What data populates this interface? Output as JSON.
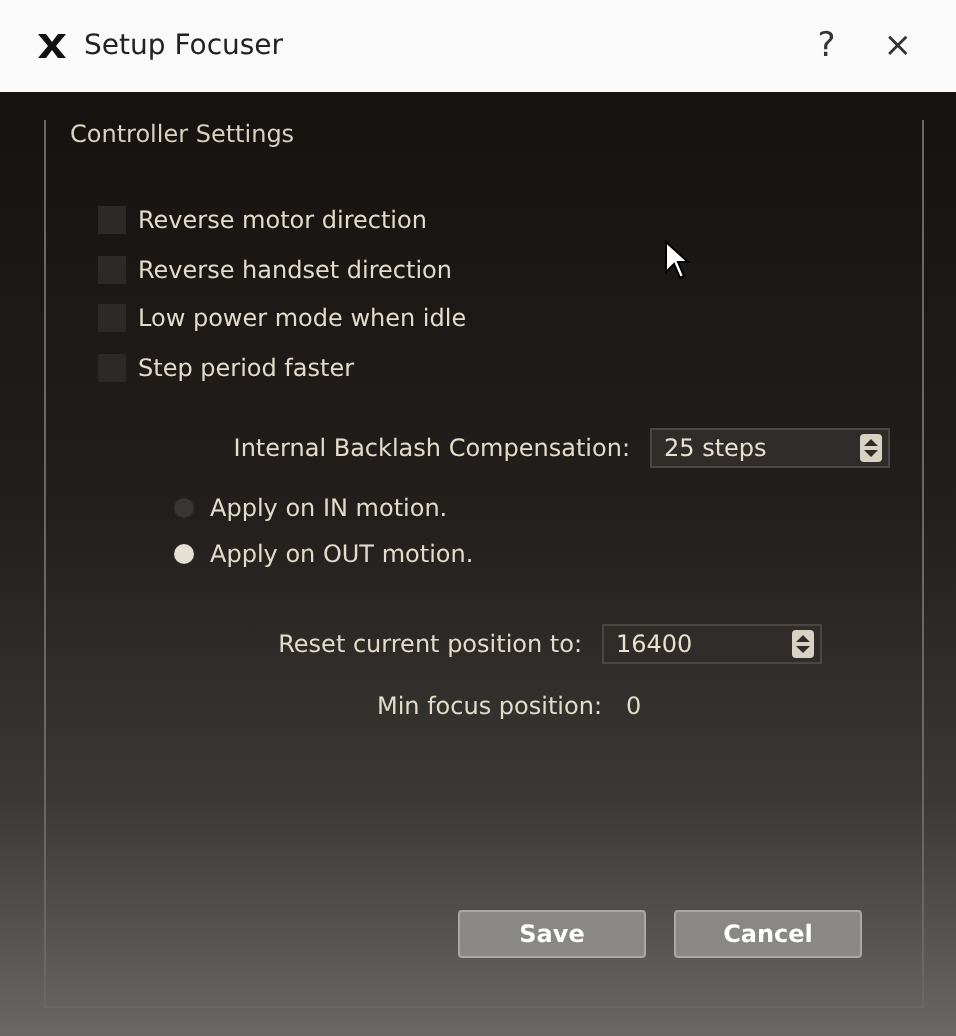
{
  "window": {
    "title": "Setup Focuser",
    "help": "?",
    "close": "×"
  },
  "group": {
    "title": "Controller Settings"
  },
  "checkboxes": [
    {
      "label": "Reverse motor direction",
      "checked": false
    },
    {
      "label": "Reverse handset direction",
      "checked": false
    },
    {
      "label": "Low power mode when idle",
      "checked": false
    },
    {
      "label": "Step period faster",
      "checked": false
    }
  ],
  "backlash": {
    "label": "Internal Backlash Compensation:",
    "value": "25 steps"
  },
  "radios": [
    {
      "label": "Apply on IN motion.",
      "selected": false
    },
    {
      "label": "Apply on OUT motion.",
      "selected": true
    }
  ],
  "reset": {
    "label": "Reset current position to:",
    "value": "16400"
  },
  "min_focus": {
    "label": "Min focus position:",
    "value": "0"
  },
  "buttons": [
    "Save",
    "Cancel"
  ]
}
